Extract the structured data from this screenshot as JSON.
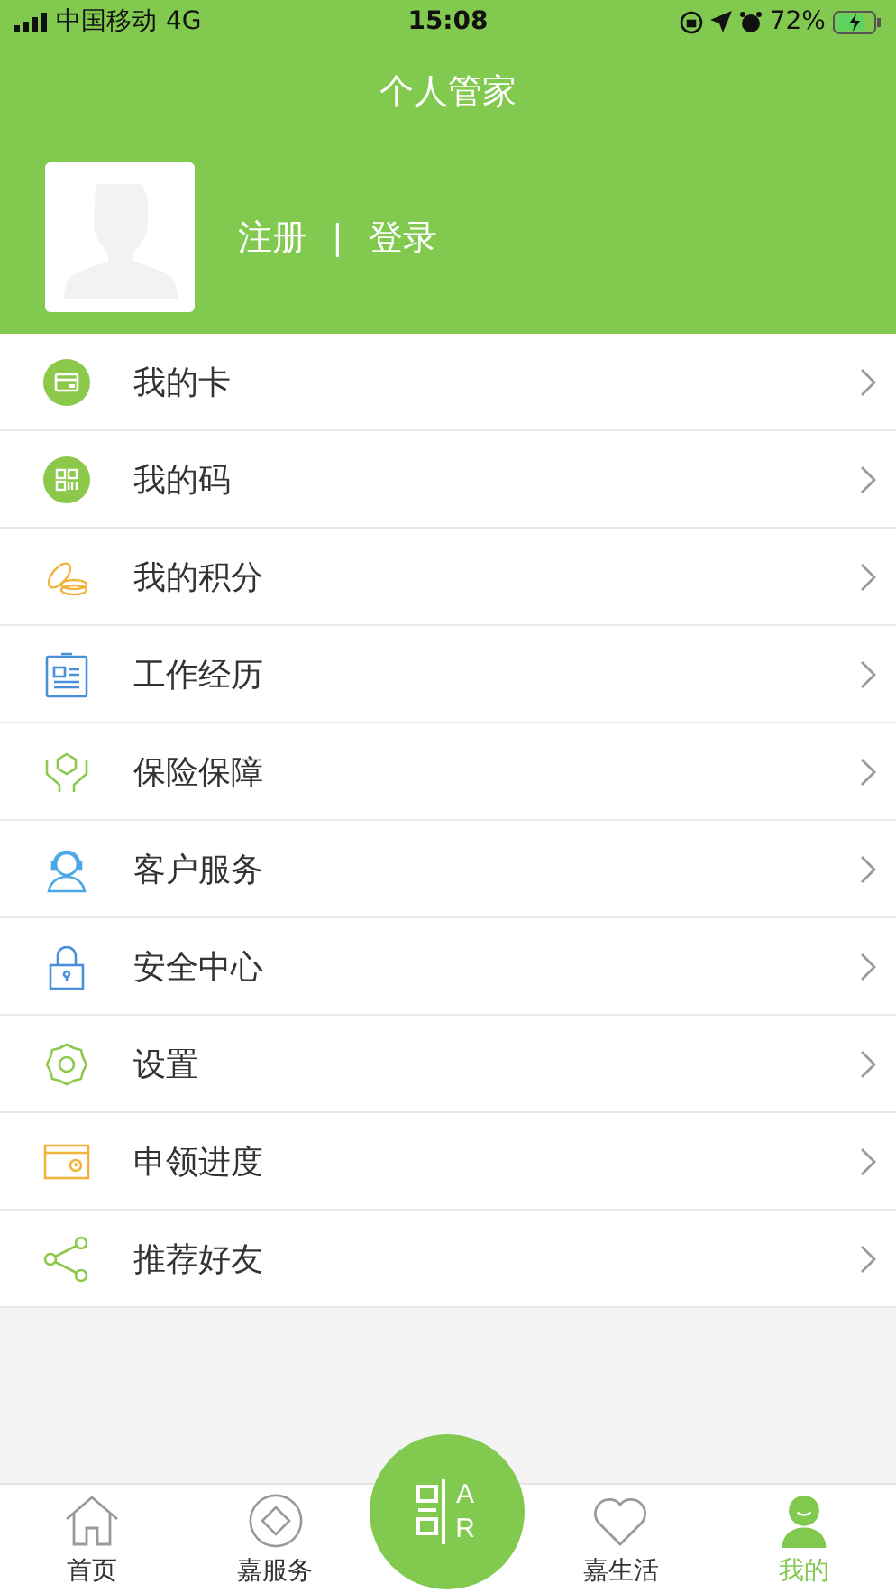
{
  "status_bar": {
    "carrier": "中国移动",
    "network": "4G",
    "time": "15:08",
    "battery": "72%"
  },
  "header": {
    "title": "个人管家",
    "register": "注册",
    "separator": "|",
    "login": "登录"
  },
  "menu": [
    {
      "kind": "card",
      "label": "我的卡"
    },
    {
      "kind": "code",
      "label": "我的码"
    },
    {
      "kind": "points",
      "label": "我的积分"
    },
    {
      "kind": "work",
      "label": "工作经历"
    },
    {
      "kind": "insurance",
      "label": "保险保障"
    },
    {
      "kind": "service",
      "label": "客户服务"
    },
    {
      "kind": "security",
      "label": "安全中心"
    },
    {
      "kind": "settings",
      "label": "设置"
    },
    {
      "kind": "progress",
      "label": "申领进度"
    },
    {
      "kind": "share",
      "label": "推荐好友"
    }
  ],
  "tab_bar": {
    "tabs": [
      {
        "kind": "home",
        "label": "首页",
        "selected": false
      },
      {
        "kind": "service",
        "label": "嘉服务",
        "selected": false
      },
      {
        "kind": "scan",
        "label": "AR"
      },
      {
        "kind": "life",
        "label": "嘉生活",
        "selected": false
      },
      {
        "kind": "mine",
        "label": "我的",
        "selected": true
      }
    ]
  }
}
